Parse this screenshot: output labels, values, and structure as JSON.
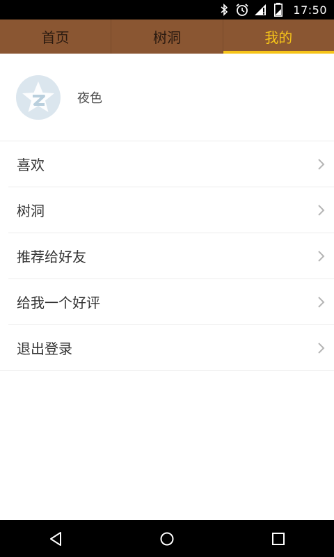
{
  "status_bar": {
    "time": "17:50",
    "icons": [
      "bluetooth-icon",
      "alarm-icon",
      "signal-icon",
      "battery-icon"
    ]
  },
  "tabs": [
    {
      "label": "首页",
      "active": false
    },
    {
      "label": "树洞",
      "active": false
    },
    {
      "label": "我的",
      "active": true
    }
  ],
  "profile": {
    "username": "夜色",
    "avatar_icon": "qzone-star-icon"
  },
  "menu": [
    {
      "label": "喜欢"
    },
    {
      "label": "树洞"
    },
    {
      "label": "推荐给好友"
    },
    {
      "label": "给我一个好评"
    },
    {
      "label": "退出登录"
    }
  ],
  "nav_bar": {
    "icons": [
      "back-icon",
      "home-icon",
      "recents-icon"
    ]
  },
  "colors": {
    "tab_bar_bg": "#8a5632",
    "accent": "#f6c419",
    "divider": "#ececec"
  }
}
